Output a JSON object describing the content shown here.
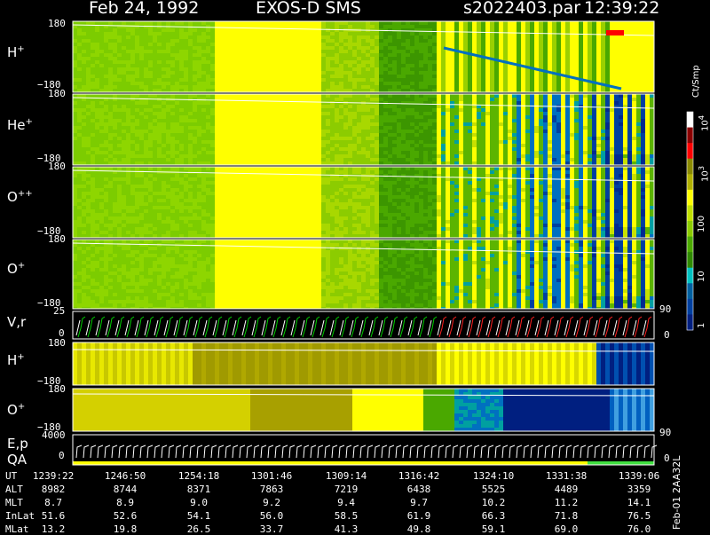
{
  "header": {
    "date": "Feb 24, 1992",
    "mission": "EXOS-D SMS",
    "file": "s2022403.par",
    "time": "12:39:22"
  },
  "chart_data": {
    "type": "heatmap",
    "panels": [
      {
        "id": "h_plus",
        "label": "H",
        "charge": "+",
        "ymax": "180",
        "ymin": "−180"
      },
      {
        "id": "he_plus",
        "label": "He",
        "charge": "+",
        "ymax": "180",
        "ymin": "−180"
      },
      {
        "id": "o_pp",
        "label": "O",
        "charge": "++",
        "ymax": "180",
        "ymin": "−180"
      },
      {
        "id": "o_plus",
        "label": "O",
        "charge": "+",
        "ymax": "180",
        "ymin": "−180"
      },
      {
        "id": "vr",
        "label": "V,r",
        "ymax": "25",
        "ymin": "0"
      },
      {
        "id": "h_plus2",
        "label": "H",
        "charge": "+",
        "ymax": "180",
        "ymin": "−180"
      },
      {
        "id": "o_plus2",
        "label": "O",
        "charge": "+",
        "ymax": "180",
        "ymin": "−180"
      },
      {
        "id": "ep",
        "label": "E,p",
        "label2": "QA",
        "ymax": "4000",
        "ymin": "0"
      }
    ],
    "right_ticks": [
      "90",
      "0",
      "90",
      "0"
    ],
    "colorbar": {
      "unit": "Ct/Smp",
      "labels": [
        "10",
        "1",
        "10",
        "100",
        "10",
        "10"
      ],
      "exponents": [
        "4",
        "",
        "3",
        "",
        "",
        ""
      ],
      "colors": [
        "#ffffff",
        "#8b0000",
        "#ff0000",
        "#8a8a00",
        "#b0b000",
        "#ffff00",
        "#c0e000",
        "#8ccc00",
        "#4caa00",
        "#2f8a00",
        "#00c0c0",
        "#0060a0",
        "#0040a0",
        "#001f80"
      ]
    },
    "table": {
      "rows": [
        {
          "name": "UT",
          "values": [
            "1239:22",
            "1246:50",
            "1254:18",
            "1301:46",
            "1309:14",
            "1316:42",
            "1324:10",
            "1331:38",
            "1339:06"
          ]
        },
        {
          "name": "ALT",
          "values": [
            "8982",
            "8744",
            "8371",
            "7863",
            "7219",
            "6438",
            "5525",
            "4489",
            "3359"
          ]
        },
        {
          "name": "MLT",
          "values": [
            "8.7",
            "8.9",
            "9.0",
            "9.2",
            "9.4",
            "9.7",
            "10.2",
            "11.2",
            "14.1"
          ]
        },
        {
          "name": "InLat",
          "values": [
            "51.6",
            "52.6",
            "54.1",
            "56.0",
            "58.5",
            "61.9",
            "66.3",
            "71.8",
            "76.5"
          ]
        },
        {
          "name": "MLat",
          "values": [
            "13.2",
            "19.8",
            "26.5",
            "33.7",
            "41.3",
            "49.8",
            "59.1",
            "69.0",
            "76.0"
          ]
        }
      ]
    },
    "version": "Feb-01 2AA32L"
  }
}
